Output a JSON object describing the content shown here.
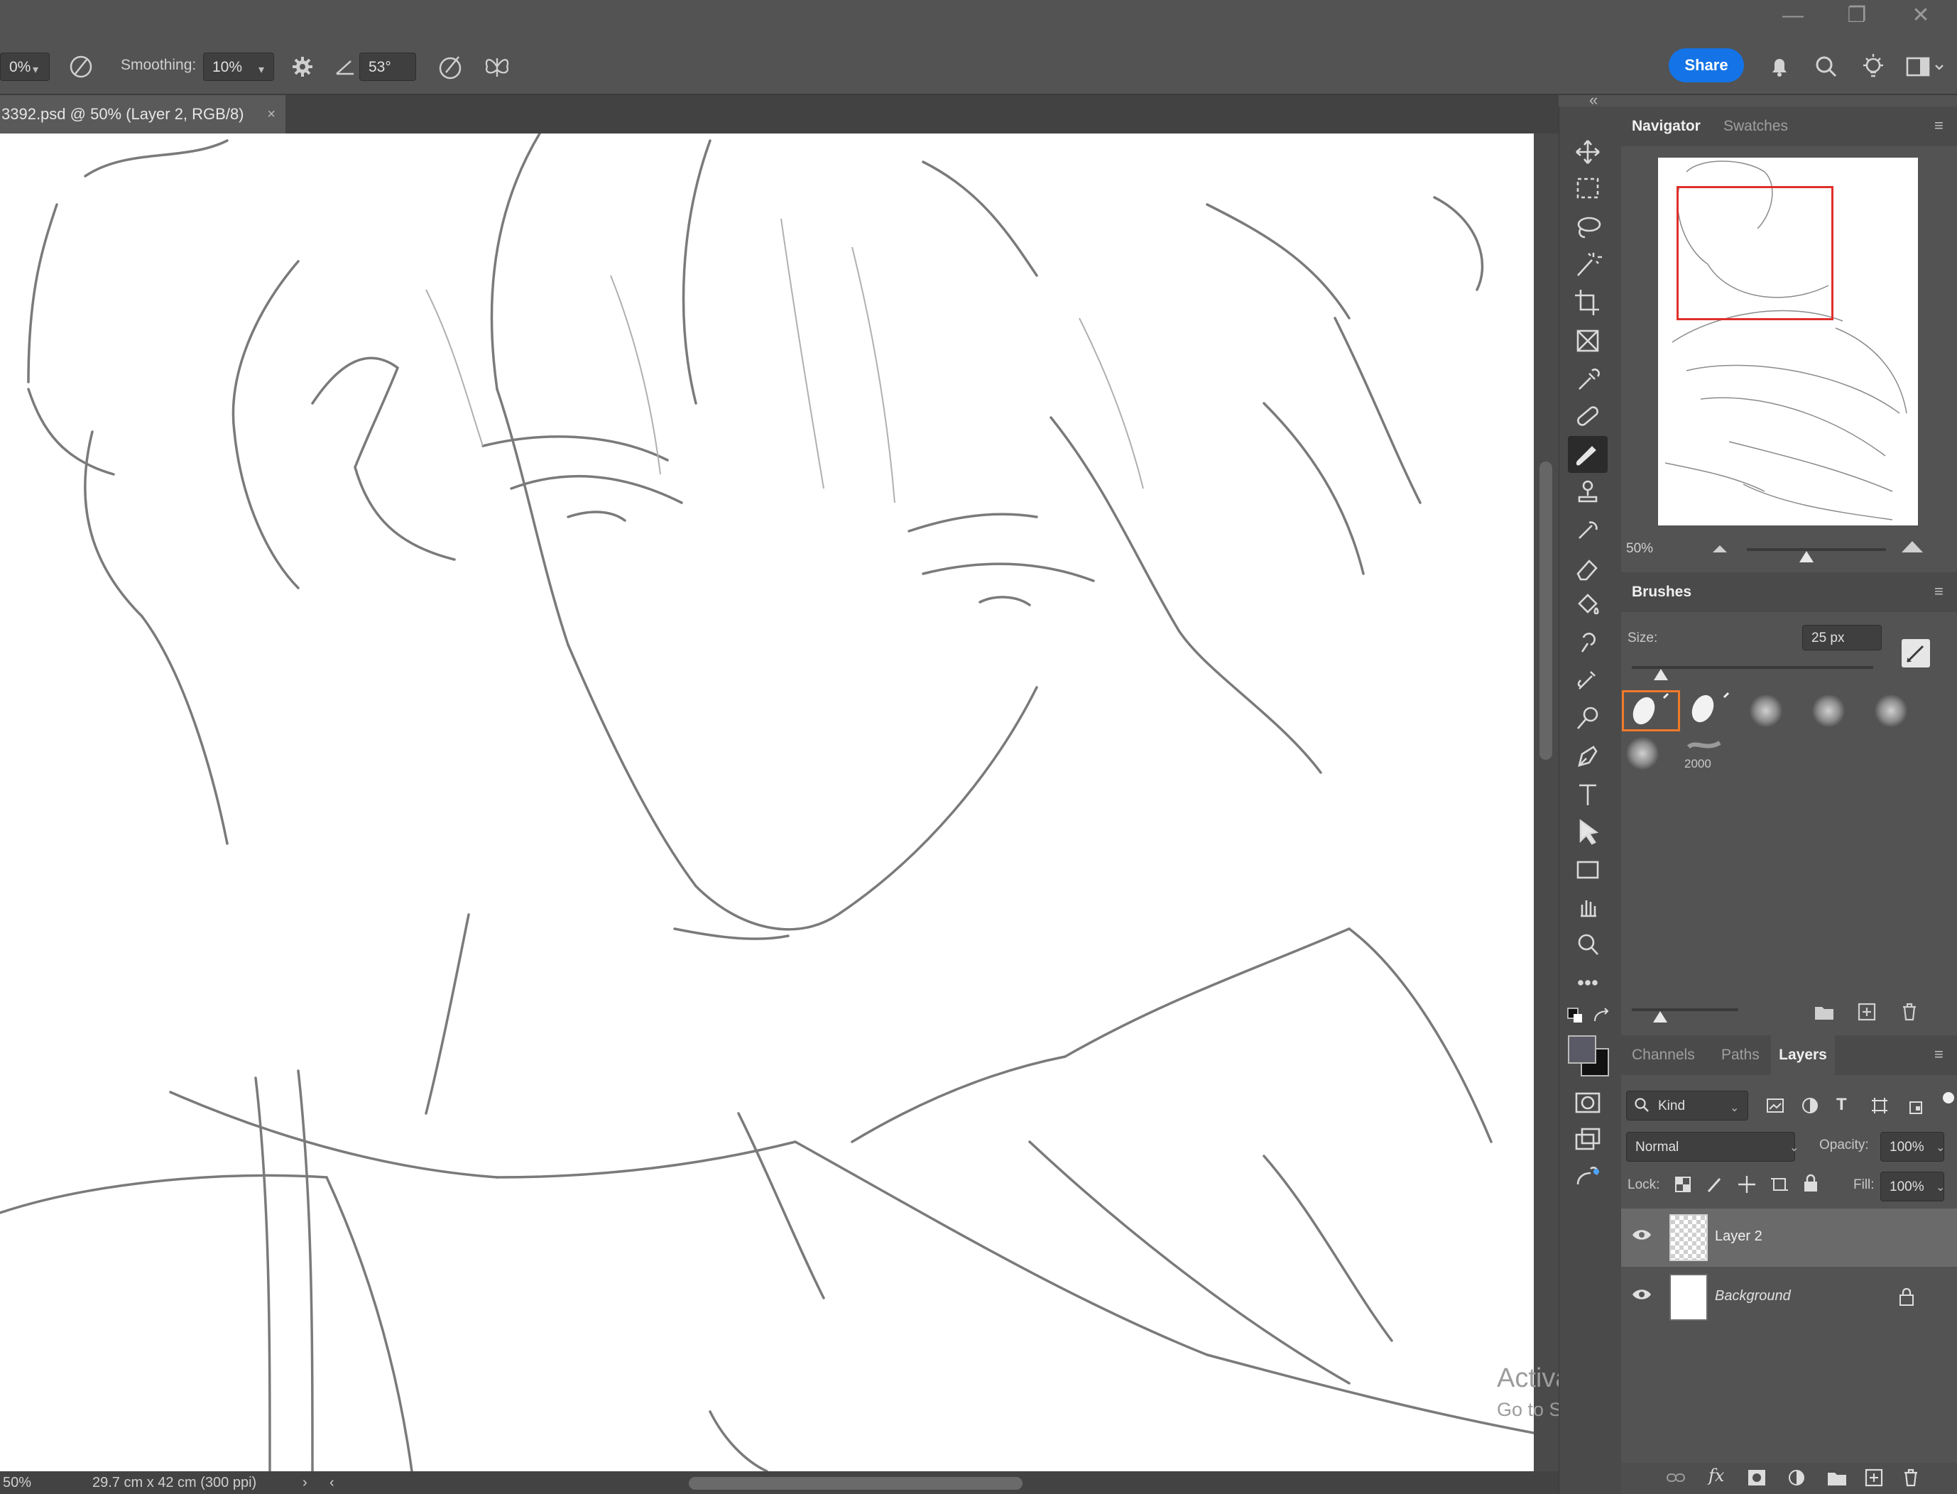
{
  "app": {
    "title_bar": {
      "minimize": "—",
      "restore": "❐",
      "close": "✕"
    },
    "options_bar": {
      "zoom_value": "0%",
      "smoothing_label": "Smoothing:",
      "smoothing_value": "10%",
      "angle_value": "53°",
      "share_label": "Share"
    },
    "document_tab": {
      "label": "3392.psd @ 50% (Layer 2, RGB/8)",
      "close": "×"
    },
    "status_bar": {
      "zoom": "50%",
      "doc_size": "29.7 cm x 42 cm (300 ppi)",
      "arrow": "›",
      "left_arrow": "‹"
    },
    "navigator": {
      "tabs": [
        "Navigator",
        "Swatches"
      ],
      "active_tab": "Navigator",
      "zoom": "50%",
      "zoom_slider_position": 0.43
    },
    "brushes": {
      "title": "Brushes",
      "size_label": "Size:",
      "size_value": "25 px",
      "size_slider_position": 0.12,
      "brush_count_label": "2000"
    },
    "layers_panel": {
      "tabs": [
        "Channels",
        "Paths",
        "Layers"
      ],
      "active_tab": "Layers",
      "filter_kind": "Kind",
      "blend_mode": "Normal",
      "opacity_label": "Opacity:",
      "opacity_value": "100%",
      "lock_label": "Lock:",
      "fill_label": "Fill:",
      "fill_value": "100%",
      "layers": [
        {
          "name": "Layer 2",
          "selected": true,
          "visible": true,
          "locked": false
        },
        {
          "name": "Background",
          "selected": false,
          "visible": true,
          "locked": true
        }
      ]
    },
    "watermark": {
      "line1": "Activate Windows",
      "line2": "Go to Settings to activate Windows."
    },
    "colors": {
      "ui_bg": "#535353",
      "panel_header": "#4a4a4a",
      "canvas_bg": "#ffffff",
      "accent_share": "#1473e6",
      "navigator_viewbox": "#e0302a",
      "brush_selected_border": "#f07a2a",
      "foreground_color": "#5a5a66",
      "background_color": "#111111"
    },
    "tools": [
      "move-tool-icon",
      "marquee-tool-icon",
      "lasso-tool-icon",
      "magic-wand-tool-icon",
      "crop-tool-icon",
      "frame-tool-icon",
      "eyedropper-tool-icon",
      "healing-brush-tool-icon",
      "brush-tool-icon",
      "clone-stamp-tool-icon",
      "history-brush-tool-icon",
      "eraser-tool-icon",
      "paint-bucket-tool-icon",
      "smudge-tool-icon",
      "mixer-brush-tool-icon",
      "dodge-tool-icon",
      "pen-tool-icon",
      "type-tool-icon",
      "path-selection-tool-icon",
      "rectangle-tool-icon",
      "hand-rotate-tool-icon",
      "zoom-tool-icon",
      "more-tools-icon"
    ]
  }
}
